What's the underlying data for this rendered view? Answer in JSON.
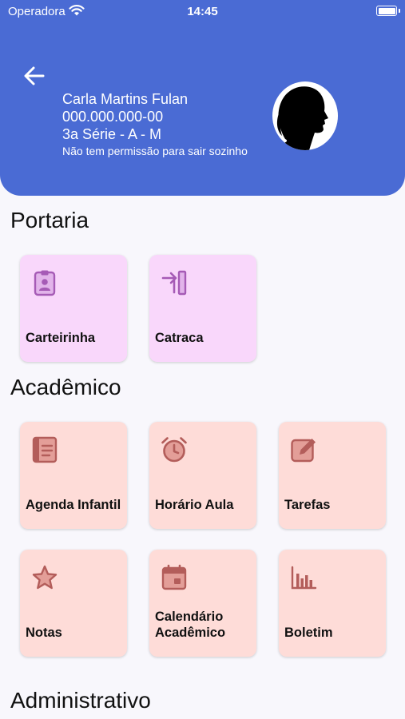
{
  "status_bar": {
    "carrier": "Operadora",
    "time": "14:45"
  },
  "student": {
    "name": "Carla Martins Fulan",
    "id": "000.000.000-00",
    "class": "3a Série - A - M",
    "permission": "Não tem permissão para sair sozinho"
  },
  "colors": {
    "header": "#4a6bd4",
    "portaria_tile": "#f9d7fb",
    "academico_tile": "#fedcd8",
    "portaria_icon": "#a65bb6",
    "academico_icon": "#b35d5a"
  },
  "sections": {
    "portaria": {
      "title": "Portaria",
      "items": [
        {
          "label": "Carteirinha",
          "icon": "id-badge-icon"
        },
        {
          "label": "Catraca",
          "icon": "turnstile-icon"
        }
      ]
    },
    "academico": {
      "title": "Acadêmico",
      "items": [
        {
          "label": "Agenda Infantil",
          "icon": "agenda-book-icon"
        },
        {
          "label": "Horário Aula",
          "icon": "alarm-clock-icon"
        },
        {
          "label": "Tarefas",
          "icon": "edit-task-icon"
        },
        {
          "label": "Notas",
          "icon": "star-icon"
        },
        {
          "label": "Calendário Acadêmico",
          "icon": "calendar-icon"
        },
        {
          "label": "Boletim",
          "icon": "bar-chart-icon"
        }
      ]
    },
    "administrativo": {
      "title": "Administrativo"
    }
  }
}
